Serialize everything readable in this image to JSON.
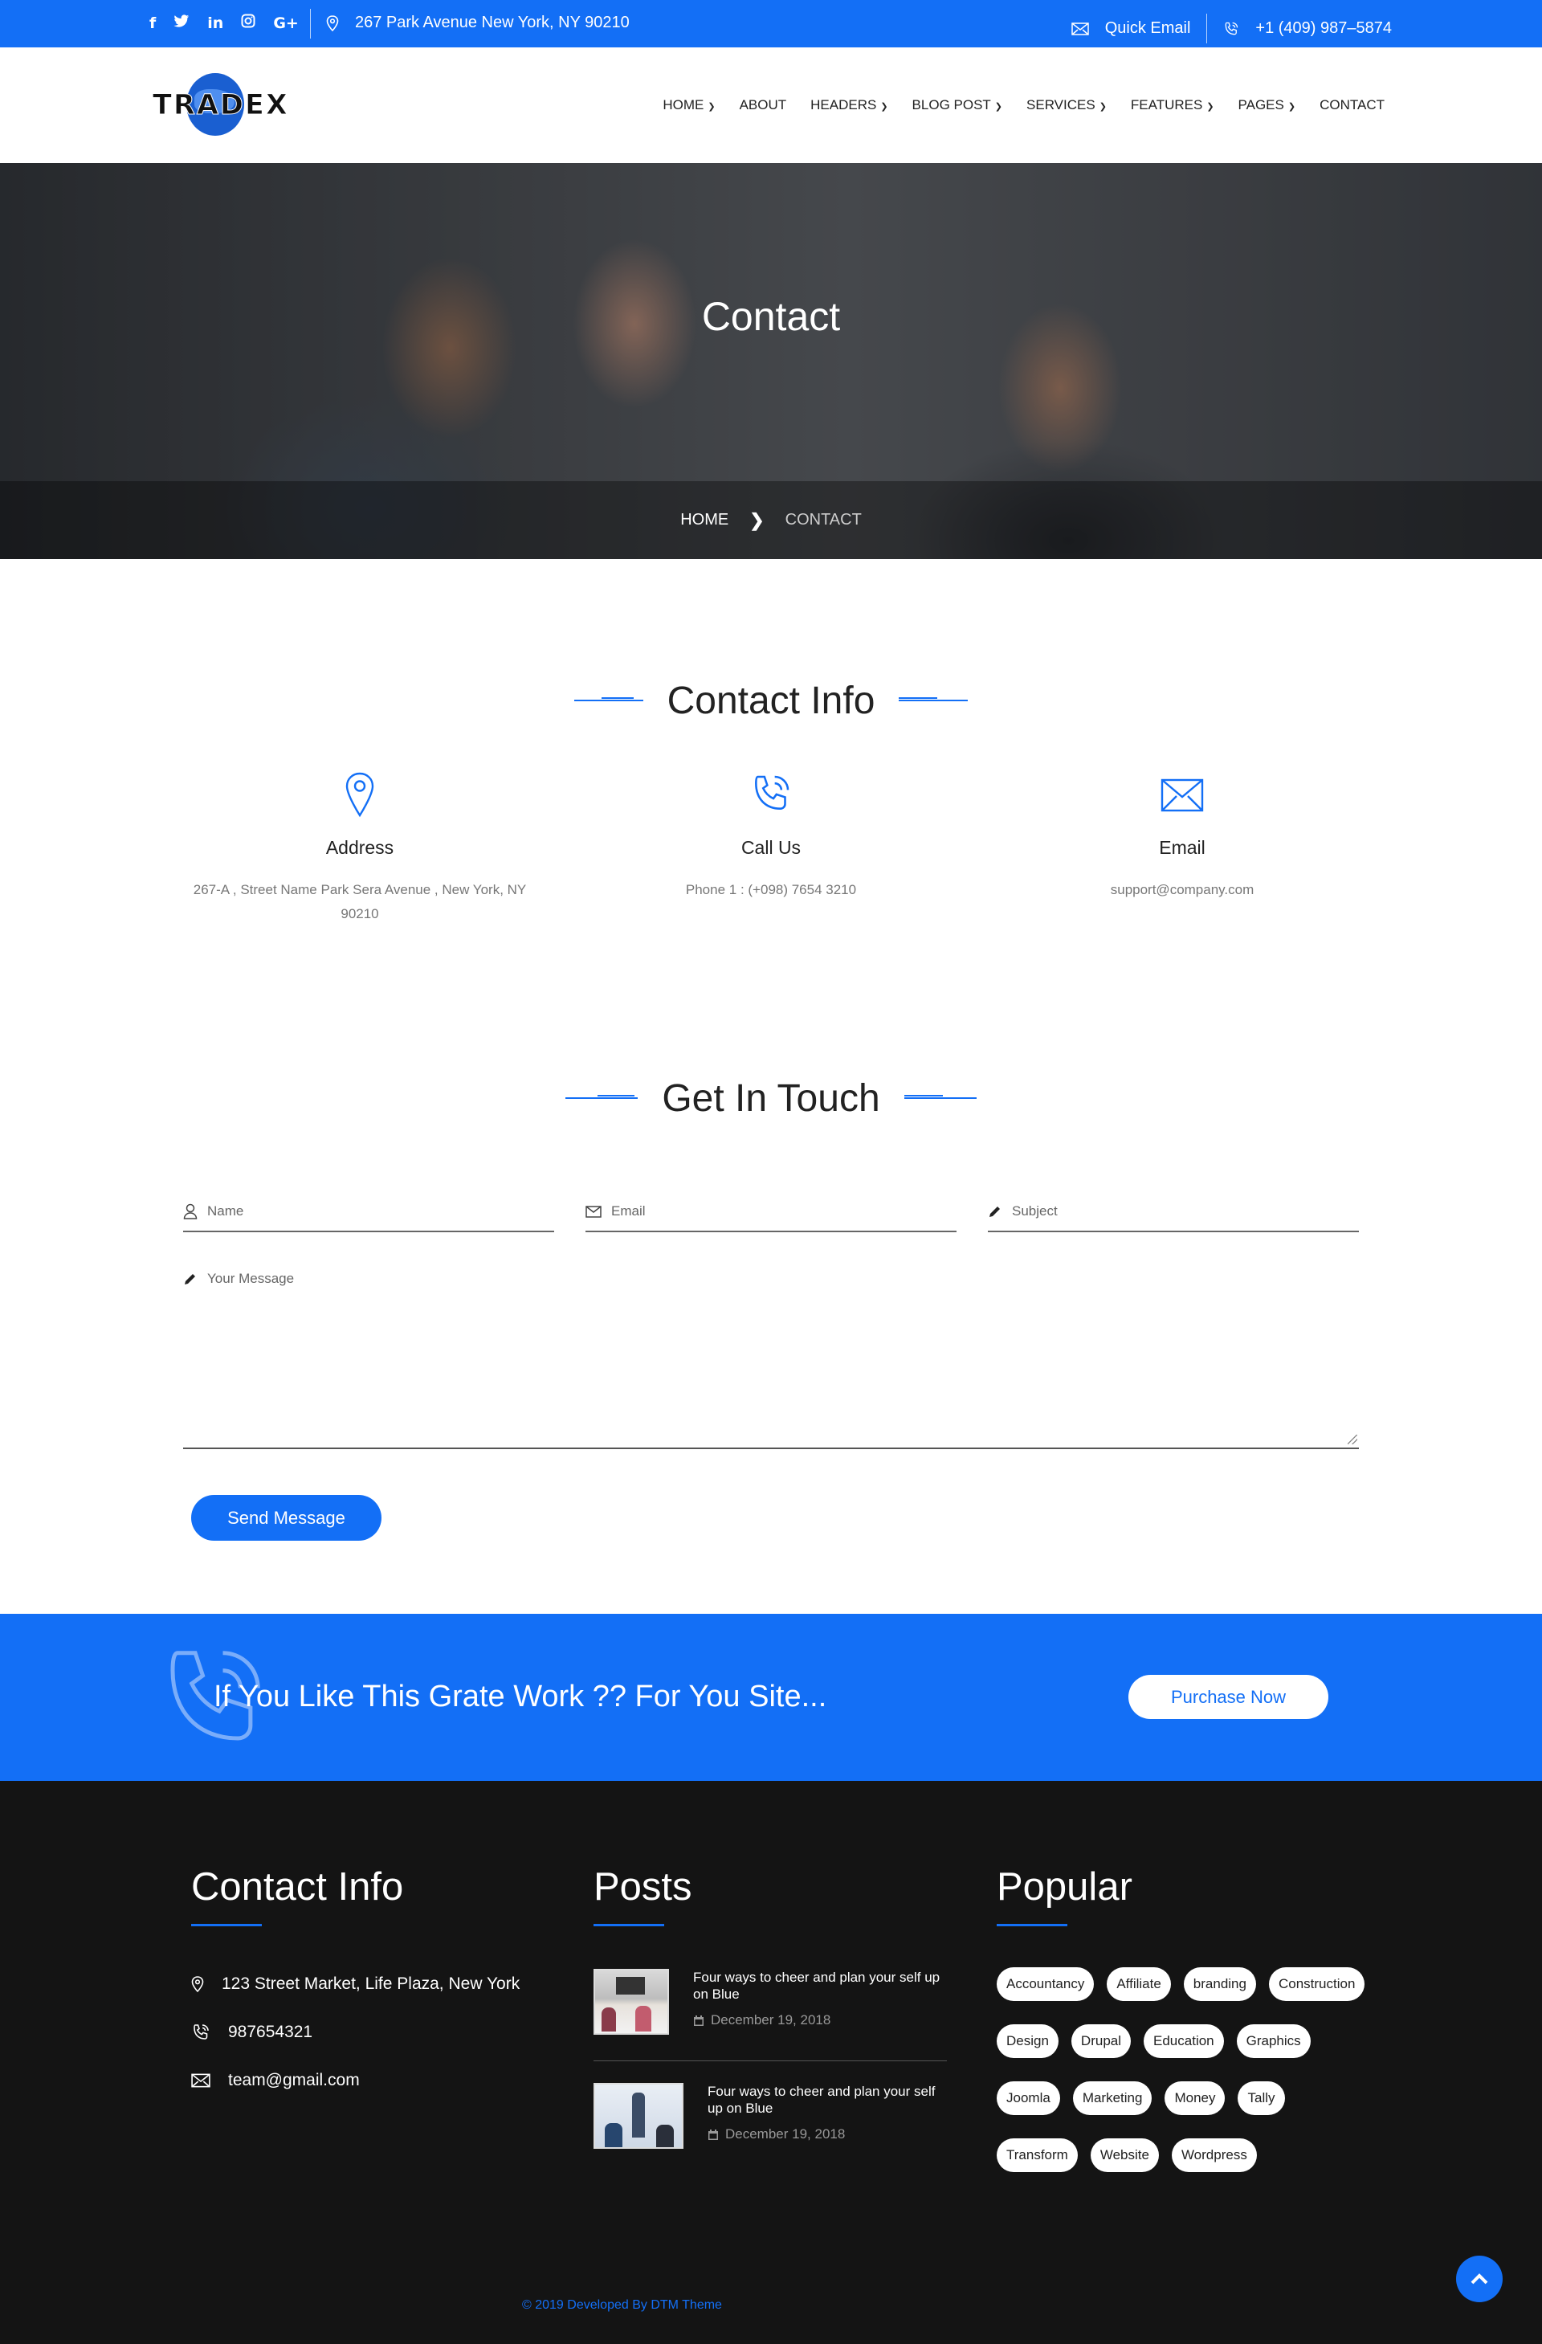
{
  "topbar": {
    "social_icons": [
      "facebook-icon",
      "twitter-icon",
      "linkedin-icon",
      "instagram-icon",
      "google-plus-icon"
    ],
    "address": "267 Park Avenue New York, NY 90210",
    "quick_email": "Quick Email",
    "phone": "+1 (409) 987–5874"
  },
  "brand": {
    "logo_text": "TRADEX"
  },
  "nav": {
    "items": [
      {
        "label": "HOME",
        "dropdown": true
      },
      {
        "label": "ABOUT",
        "dropdown": false
      },
      {
        "label": "HEADERS",
        "dropdown": true
      },
      {
        "label": "BLOG POST",
        "dropdown": true
      },
      {
        "label": "SERVICES",
        "dropdown": true
      },
      {
        "label": "FEATURES",
        "dropdown": true
      },
      {
        "label": "PAGES",
        "dropdown": true
      },
      {
        "label": "CONTACT",
        "dropdown": false
      }
    ]
  },
  "hero": {
    "title": "Contact",
    "breadcrumb_home": "HOME",
    "breadcrumb_current": "CONTACT"
  },
  "contact_info": {
    "title": "Contact Info",
    "address": {
      "heading": "Address",
      "text": "267-A , Street Name Park Sera Avenue , New York, NY 90210"
    },
    "call": {
      "heading": "Call Us",
      "text": "Phone 1 : (+098) 7654 3210"
    },
    "email": {
      "heading": "Email",
      "text": "support@company.com"
    }
  },
  "form": {
    "title": "Get In Touch",
    "name_placeholder": "Name",
    "email_placeholder": "Email",
    "subject_placeholder": "Subject",
    "message_placeholder": "Your Message",
    "submit_label": "Send Message"
  },
  "cta": {
    "text": "If You Like This Grate Work ?? For You Site...",
    "button_label": "Purchase Now"
  },
  "footer": {
    "contact": {
      "title": "Contact Info",
      "address": "123 Street Market, Life Plaza, New York",
      "phone": "987654321",
      "email": "team@gmail.com"
    },
    "posts": {
      "title": "Posts",
      "items": [
        {
          "title": "Four ways to cheer and plan your self up on Blue",
          "date": "December 19, 2018"
        },
        {
          "title": "Four ways to cheer and plan your self up on Blue",
          "date": "December 19, 2018"
        }
      ]
    },
    "popular": {
      "title": "Popular",
      "tags": [
        "Accountancy",
        "Affiliate",
        "branding",
        "Construction",
        "Design",
        "Drupal",
        "Education",
        "Graphics",
        "Joomla",
        "Marketing",
        "Money",
        "Tally",
        "Transform",
        "Website",
        "Wordpress"
      ]
    },
    "copyright": "© 2019 Developed By DTM Theme"
  },
  "colors": {
    "accent": "#136ff6",
    "footer_bg": "#141414"
  }
}
